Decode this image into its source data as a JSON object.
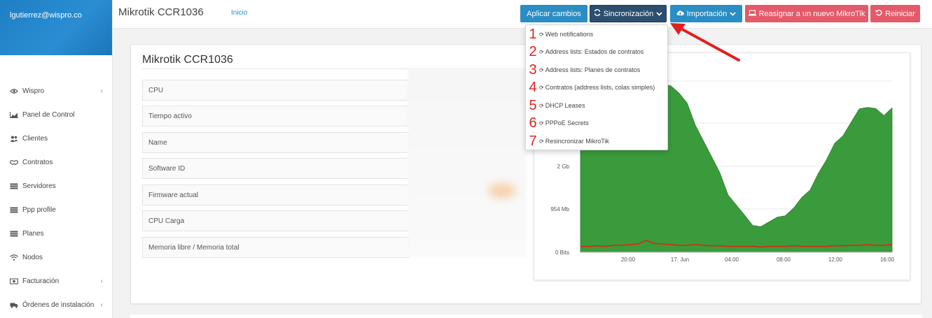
{
  "user": {
    "email": "lgutierrez@wispro.co"
  },
  "sidebar": {
    "items": [
      {
        "label": "Wispro",
        "icon": "eye-icon",
        "has_children": true
      },
      {
        "label": "Panel de Control",
        "icon": "chart-icon",
        "has_children": false
      },
      {
        "label": "Clientes",
        "icon": "users-icon",
        "has_children": false
      },
      {
        "label": "Contratos",
        "icon": "handshake-icon",
        "has_children": false
      },
      {
        "label": "Servidores",
        "icon": "server-icon",
        "has_children": false
      },
      {
        "label": "Ppp profile",
        "icon": "server-icon",
        "has_children": false
      },
      {
        "label": "Planes",
        "icon": "server-icon",
        "has_children": false
      },
      {
        "label": "Nodos",
        "icon": "wifi-icon",
        "has_children": false
      },
      {
        "label": "Facturación",
        "icon": "money-icon",
        "has_children": true
      },
      {
        "label": "Órdenes de instalación",
        "icon": "truck-icon",
        "has_children": true
      }
    ]
  },
  "header": {
    "title": "Mikrotik CCR1036",
    "breadcrumb": "Inicio",
    "buttons": {
      "apply": "Aplicar cambios",
      "sync": "Sincronización",
      "import": "Importación",
      "reassign": "Reasignar a un nuevo MikroTik",
      "reset": "Reiniciar"
    }
  },
  "sync_menu": {
    "items": [
      {
        "num": "1",
        "label": "Web notifications"
      },
      {
        "num": "2",
        "label": "Address lists: Estados de contratos"
      },
      {
        "num": "3",
        "label": "Address lists: Planes de contratos"
      },
      {
        "num": "4",
        "label": "Contratos (address lists, colas simples)"
      },
      {
        "num": "5",
        "label": "DHCP Leases"
      },
      {
        "num": "6",
        "label": "PPPoE Secrets"
      },
      {
        "num": "7",
        "label": "Resincronizar MikroTik"
      }
    ]
  },
  "device": {
    "title": "Mikrotik CCR1036",
    "fields": [
      "CPU",
      "Tiempo activo",
      "Name",
      "Software ID",
      "Firmware actual",
      "CPU Carga",
      "Memoria libre / Memoria total"
    ]
  },
  "colors": {
    "sidebar_header": "#2a8dd2",
    "primary": "#2a8dc4",
    "sync_button": "#2c4f6f",
    "danger": "#e55a6a",
    "chart_area": "#3a9b3c",
    "chart_line": "#d62a10",
    "annotation": "#e02020"
  },
  "chart_data": {
    "type": "area",
    "y_ticks": [
      "0 Bits",
      "954 Mb",
      "2 Gb"
    ],
    "x_ticks": [
      "20:00",
      "17. Jun",
      "04:00",
      "08:00",
      "12:00",
      "16:00"
    ],
    "series": [
      {
        "values": [
          2.6,
          2.55,
          2.5,
          2.52,
          2.45,
          2.5,
          2.55,
          2.6,
          2.65,
          2.7,
          2.8,
          2.85,
          2.7,
          2.5,
          2.2,
          1.9,
          1.6,
          1.3,
          1.0,
          0.8,
          0.6,
          0.5,
          0.45,
          0.5,
          0.55,
          0.65,
          0.75,
          0.9,
          1.1,
          1.35,
          1.55,
          1.8,
          2.0,
          2.2,
          2.4,
          2.5,
          2.45,
          2.3,
          2.4
        ]
      },
      {
        "values": [
          0.1,
          0.1,
          0.11,
          0.1,
          0.12,
          0.12,
          0.13,
          0.14,
          0.2,
          0.15,
          0.14,
          0.13,
          0.12,
          0.12,
          0.13,
          0.12,
          0.11,
          0.11,
          0.1,
          0.1,
          0.1,
          0.1,
          0.09,
          0.1,
          0.1,
          0.1,
          0.11,
          0.1,
          0.1,
          0.1,
          0.1,
          0.11,
          0.11,
          0.12,
          0.12,
          0.13,
          0.12,
          0.12,
          0.13
        ]
      }
    ],
    "y_max": 2.9
  }
}
